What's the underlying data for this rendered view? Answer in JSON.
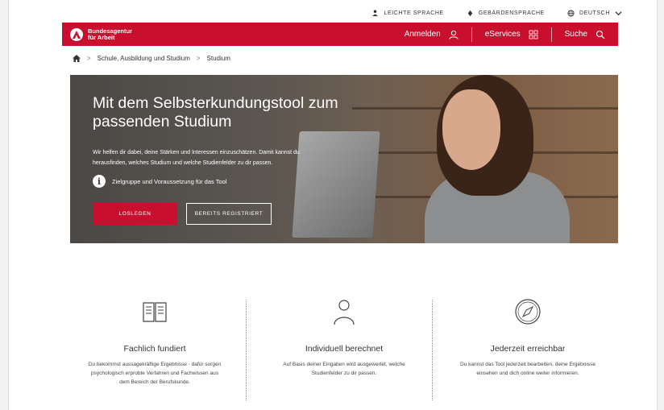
{
  "utility": {
    "easy_language": "LEICHTE SPRACHE",
    "sign_language": "GEBÄRDENSPRACHE",
    "language": "DEUTSCH"
  },
  "header": {
    "logo_line1": "Bundesagentur",
    "logo_line2": "für Arbeit",
    "login": "Anmelden",
    "eservices": "eServices",
    "search": "Suche"
  },
  "breadcrumb": {
    "items": [
      "Schule, Ausbildung und Studium",
      "Studium"
    ],
    "separator": ">"
  },
  "hero": {
    "title": "Mit dem Selbsterkundungstool zum passenden Studium",
    "text": "Wir helfen dir dabei, deine Stärken und Interessen einzuschätzen. Damit kannst du herausfinden, welches Studium und welche Studienfelder zu dir passen.",
    "info_icon": "i",
    "info": "Zielgruppe und Voraussetzung für das Tool",
    "primary_button": "LOSLEGEN",
    "secondary_button": "BEREITS REGISTRIERT"
  },
  "features": [
    {
      "icon": "book-icon",
      "title": "Fachlich fundiert",
      "text": "Du bekommst aussagekräftige Ergebnisse - dafür sorgen psychologisch erprobte Verfahren und Fachwissen aus dem Bereich der Berufskunde."
    },
    {
      "icon": "person-icon",
      "title": "Individuell berechnet",
      "text": "Auf Basis deiner Eingaben wird ausgewertet, welche Studienfelder zu dir passen."
    },
    {
      "icon": "compass-icon",
      "title": "Jederzeit erreichbar",
      "text": "Du kannst das Tool jederzeit bearbeiten, deine Ergebnisse einsehen und dich online weiter informieren."
    }
  ],
  "colors": {
    "brand_red": "#c8102e",
    "white": "#ffffff"
  }
}
